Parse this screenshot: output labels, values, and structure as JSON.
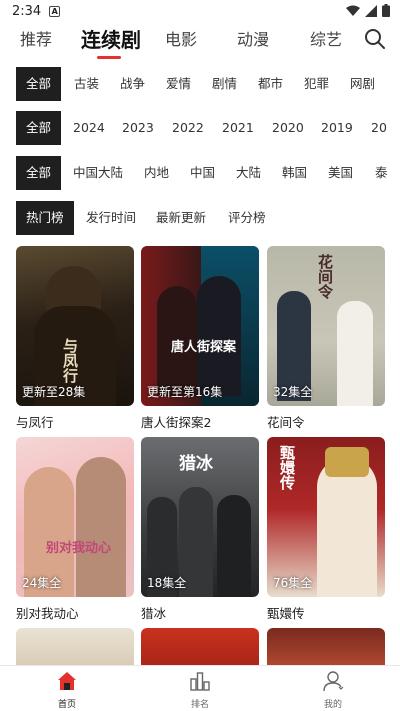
{
  "status_bar": {
    "time": "2:34",
    "badge": "A"
  },
  "top_tabs": {
    "items": [
      "推荐",
      "连续剧",
      "电影",
      "动漫",
      "综艺"
    ],
    "active_index": 1
  },
  "filters": {
    "genre": [
      "全部",
      "古装",
      "战争",
      "爱情",
      "剧情",
      "都市",
      "犯罪",
      "网剧"
    ],
    "year": [
      "全部",
      "2024",
      "2023",
      "2022",
      "2021",
      "2020",
      "2019",
      "20"
    ],
    "region": [
      "全部",
      "中国大陆",
      "内地",
      "中国",
      "大陆",
      "韩国",
      "美国",
      "泰"
    ],
    "sort": [
      "热门榜",
      "发行时间",
      "最新更新",
      "评分榜"
    ]
  },
  "cards": [
    {
      "title": "与凤行",
      "badge": "更新至28集",
      "poster_text": "与凤行"
    },
    {
      "title": "唐人街探案2",
      "badge": "更新至第16集",
      "poster_text": "唐人街探案"
    },
    {
      "title": "花间令",
      "badge": "32集全",
      "poster_text": "花间令"
    },
    {
      "title": "别对我动心",
      "badge": "24集全",
      "poster_text": "别对我动心"
    },
    {
      "title": "猎冰",
      "badge": "18集全",
      "poster_text": "猎冰"
    },
    {
      "title": "甄嬛传",
      "badge": "76集全",
      "poster_text": "甄嬛传"
    }
  ],
  "bottom_nav": [
    {
      "label": "首页",
      "icon": "home-icon",
      "active": true
    },
    {
      "label": "排名",
      "icon": "ranking-icon",
      "active": false
    },
    {
      "label": "我的",
      "icon": "profile-icon",
      "active": false
    }
  ],
  "colors": {
    "accent": "#e4312b",
    "chip_selected_bg": "#1f1f1f"
  }
}
